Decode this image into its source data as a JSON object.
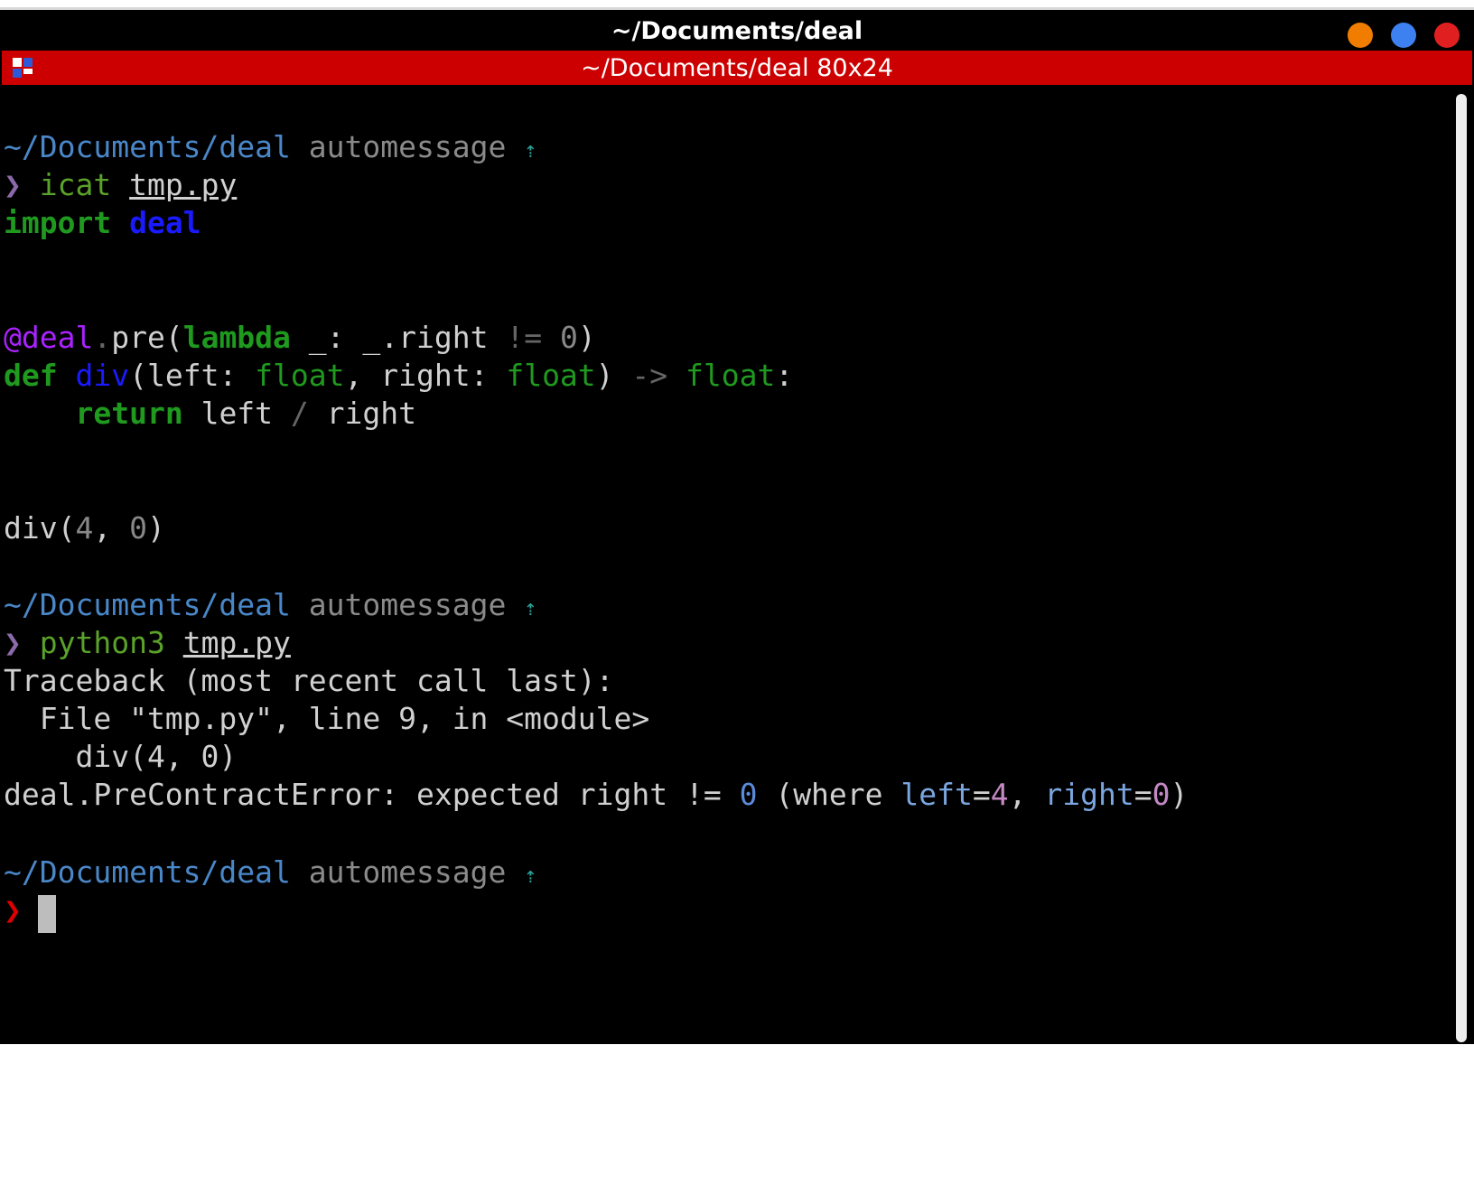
{
  "window": {
    "title": "~/Documents/deal",
    "tab_title": "~/Documents/deal 80x24",
    "controls": {
      "minimize_color": "#f07d00",
      "maximize_color": "#3d80f0",
      "close_color": "#e02020"
    }
  },
  "prompt": {
    "path": "~/Documents/deal",
    "branch": "automessage",
    "arrow": "⇡",
    "symbol": "❯"
  },
  "session": {
    "cmd1": {
      "program": "icat",
      "file": "tmp.py"
    },
    "source": {
      "l1_kw": "import",
      "l1_mod": "deal",
      "l2_deco": "@deal",
      "l2_dot": ".",
      "l2_pre": "pre(",
      "l2_lambda": "lambda",
      "l2_a": " _",
      "l2_colon": ": ",
      "l2_b": "_",
      "l2_c": ".right ",
      "l2_ne": "!=",
      "l2_sp": " ",
      "l2_zero": "0",
      "l2_close": ")",
      "l3_def": "def",
      "l3_name": "div",
      "l3_open": "(left: ",
      "l3_float1": "float",
      "l3_mid": ", right: ",
      "l3_float2": "float",
      "l3_close": ") ",
      "l3_arrow": "->",
      "l3_float3": "float",
      "l3_colon": ":",
      "l4_indent": "    ",
      "l4_return": "return",
      "l4_left": " left ",
      "l4_div": "/",
      "l4_right": " right",
      "l5_call": "div(",
      "l5_four": "4",
      "l5_comma": ", ",
      "l5_zero": "0",
      "l5_close": ")"
    },
    "cmd2": {
      "program": "python3",
      "file": "tmp.py"
    },
    "traceback": {
      "header": "Traceback (most recent call last):",
      "file_line": "  File \"tmp.py\", line 9, in <module>",
      "code_line": "    div(4, 0)",
      "err_a": "deal.PreContractError: expected right != ",
      "err_zero": "0",
      "err_b": " (where ",
      "err_left": "left",
      "err_eq1": "=",
      "err_four": "4",
      "err_c": ", ",
      "err_right": "right",
      "err_eq2": "=",
      "err_zero2": "0",
      "err_close": ")"
    }
  }
}
